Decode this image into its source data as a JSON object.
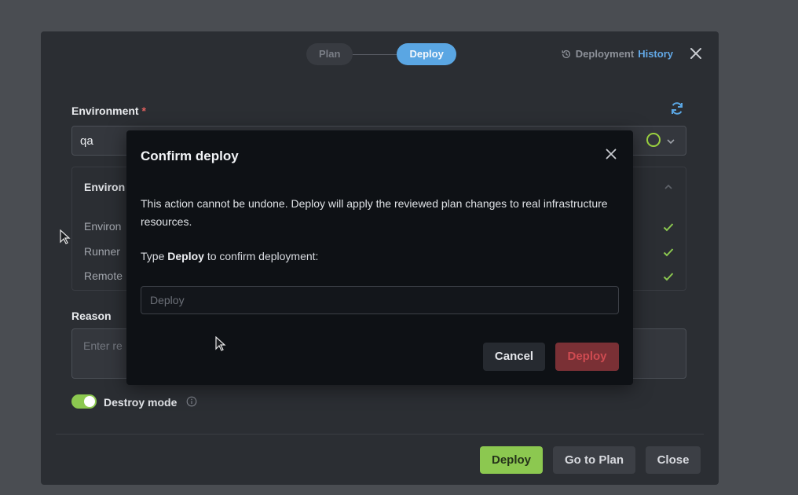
{
  "stepper": {
    "steps": [
      "Plan",
      "Deploy"
    ],
    "active": "Deploy"
  },
  "header": {
    "history_prefix": "Deployment",
    "history_highlight": "History",
    "close_icon": "close-icon",
    "history_icon": "history-icon"
  },
  "environment": {
    "label": "Environment",
    "required_mark": "*",
    "value": "qa",
    "status_color": "#9bd23f"
  },
  "checks": {
    "title": "Environ",
    "rows": [
      "Environ",
      "Runner",
      "Remote"
    ],
    "check_color": "#8cc850"
  },
  "reason": {
    "label": "Reason",
    "placeholder": "Enter re"
  },
  "destroy": {
    "label": "Destroy mode",
    "enabled": true
  },
  "footer": {
    "deploy": "Deploy",
    "go_to_plan": "Go to Plan",
    "close": "Close"
  },
  "modal": {
    "title": "Confirm deploy",
    "message": "This action cannot be undone. Deploy will apply the reviewed plan changes to real infrastructure resources.",
    "prompt_prefix": "Type",
    "prompt_keyword": "Deploy",
    "prompt_suffix": "to confirm deployment:",
    "input_placeholder": "Deploy",
    "input_value": "",
    "cancel": "Cancel",
    "confirm": "Deploy"
  },
  "colors": {
    "accent": "#5aa6e3",
    "success": "#8cc850",
    "danger": "#7a3035",
    "danger_text": "#cf4b51"
  }
}
